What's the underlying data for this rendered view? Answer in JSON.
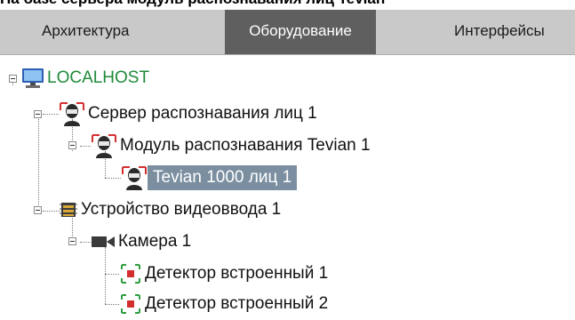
{
  "page": {
    "cut_heading": "На базе сервера модуль распознавания лиц Tevian"
  },
  "tabs": [
    {
      "label": "Архитектура",
      "active": false
    },
    {
      "label": "Оборудование",
      "active": true
    },
    {
      "label": "Интерфейсы",
      "active": false
    }
  ],
  "tree": {
    "localhost": "LOCALHOST",
    "face_server": "Сервер распознавания лиц 1",
    "tevian_module": "Модуль распознавания Tevian 1",
    "tevian_faces": "Tevian 1000 лиц 1",
    "video_device": "Устройство видеоввода 1",
    "camera": "Камера 1",
    "detector_1": "Детектор встроенный 1",
    "detector_2": "Детектор встроенный 2"
  },
  "colors": {
    "tabbar": "#c9c9c9",
    "active_tab": "#5f5f5f",
    "selection": "#7b8fa1",
    "host_label": "#1f8a3a",
    "icon_red": "#d32f2f",
    "icon_green": "#2e9e3e"
  },
  "icons": {
    "host": "computer-icon",
    "face": "face-recognition-icon",
    "device": "video-input-device-icon",
    "camera": "camera-icon",
    "detector": "detector-icon"
  }
}
